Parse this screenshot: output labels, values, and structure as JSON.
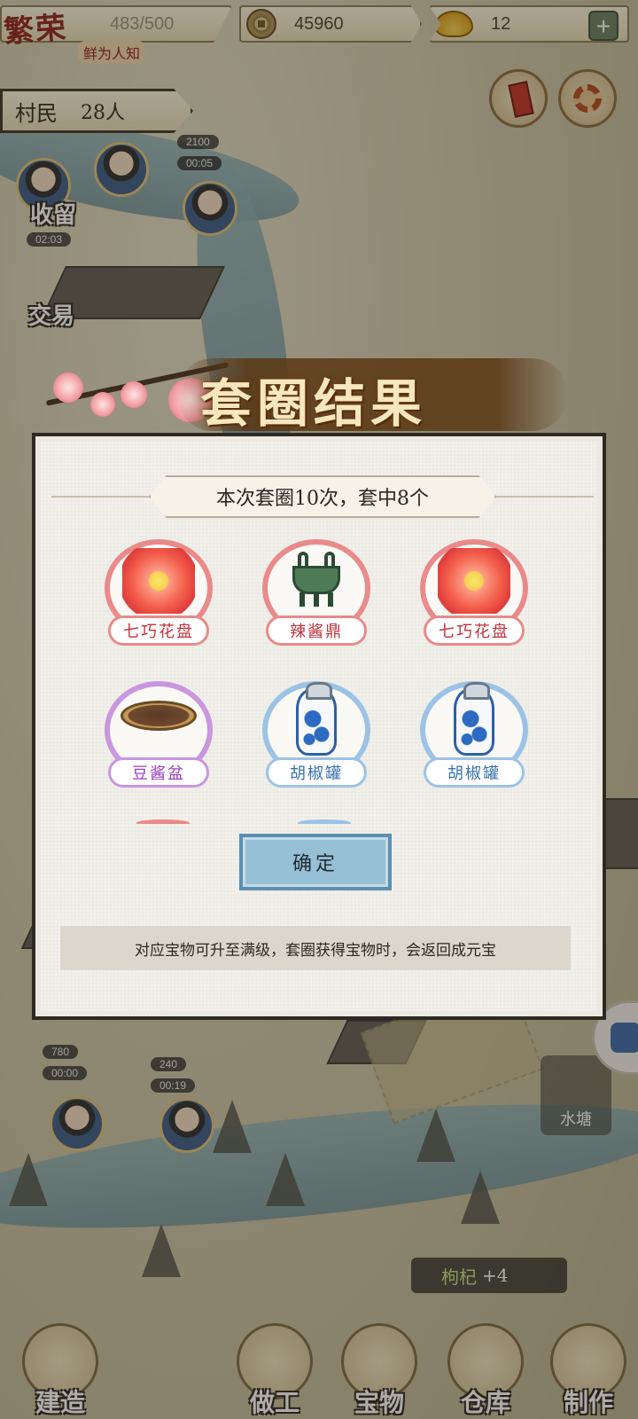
{
  "hud": {
    "prosperity": "483/500",
    "logo_text": "繁荣",
    "logo_sub": "鲜为人知",
    "coins": "45960",
    "gold": "12",
    "plus_symbol": "+",
    "coin_icon": "copper-coin-icon",
    "gold_icon": "gold-ingot-icon"
  },
  "villagers": {
    "label": "村民",
    "count": "28人"
  },
  "side": {
    "shelter_label": "收留",
    "shelter_timer": "02:03",
    "trade_label": "交易",
    "reward1": "2100",
    "timer1": "00:05",
    "reward2": "780",
    "timer2": "00:00",
    "reward3": "240",
    "timer3": "00:19",
    "water_label": "水塘"
  },
  "notification": {
    "item": "枸杞",
    "amount": "+4"
  },
  "bottom_nav": [
    {
      "label": "建造"
    },
    {
      "label": "做工"
    },
    {
      "label": "宝物"
    },
    {
      "label": "仓库"
    },
    {
      "label": "制作"
    }
  ],
  "dialog": {
    "title": "套圈结果",
    "summary": "本次套圈10次，套中8个",
    "items": [
      {
        "name": "七巧花盘",
        "rarity": "red",
        "icon": "flower-plate-icon"
      },
      {
        "name": "辣酱鼎",
        "rarity": "red",
        "icon": "bronze-ding-icon"
      },
      {
        "name": "七巧花盘",
        "rarity": "red",
        "icon": "flower-plate-icon"
      },
      {
        "name": "豆酱盆",
        "rarity": "purple",
        "icon": "bean-paste-basin-icon"
      },
      {
        "name": "胡椒罐",
        "rarity": "blue",
        "icon": "pepper-jar-icon"
      },
      {
        "name": "胡椒罐",
        "rarity": "blue",
        "icon": "pepper-jar-icon"
      }
    ],
    "confirm_label": "确定",
    "tip": "对应宝物可升至满级，套圈获得宝物时，会返回成元宝"
  },
  "colors": {
    "rarity_red": "#ea8a8a",
    "rarity_purple": "#c996df",
    "rarity_blue": "#9cc3e6",
    "confirm_bg": "#97bfd5"
  }
}
